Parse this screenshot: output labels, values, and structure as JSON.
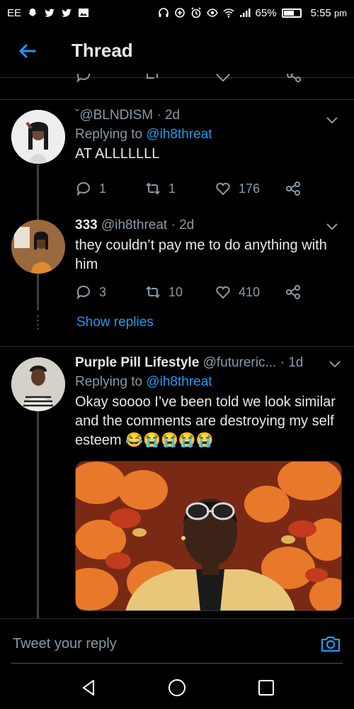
{
  "status_bar": {
    "carrier": "EE",
    "battery": "65%",
    "battery_level": 0.65,
    "time": "5:55",
    "ampm": "pm"
  },
  "header": {
    "title": "Thread"
  },
  "tweets": [
    {
      "display_name": "",
      "handle": "ˇ@BLNDISM",
      "time": "· 2d",
      "replying_label": "Replying to",
      "replying_to": "@ih8threat",
      "text": "AT ALLLLLLL",
      "replies": "1",
      "retweets": "1",
      "likes": "176"
    },
    {
      "display_name": "333",
      "handle": "@ih8threat",
      "time": "· 2d",
      "text": "they couldn’t pay me to do anything with him",
      "replies": "3",
      "retweets": "10",
      "likes": "410",
      "show_replies": "Show replies"
    },
    {
      "display_name": "Purple Pill Lifestyle",
      "handle": "@futureric...",
      "time": "· 1d",
      "replying_label": "Replying to",
      "replying_to": "@ih8threat",
      "text": "Okay soooo I’ve been told we look similar and the comments are destroying my self esteem",
      "emojis": "😂😭😭😭😭"
    }
  ],
  "reply_bar": {
    "placeholder": "Tweet your reply"
  },
  "colors": {
    "accent": "#1d9bf0",
    "muted": "#8899a6",
    "background": "#000000",
    "text": "#e7e9ea"
  }
}
